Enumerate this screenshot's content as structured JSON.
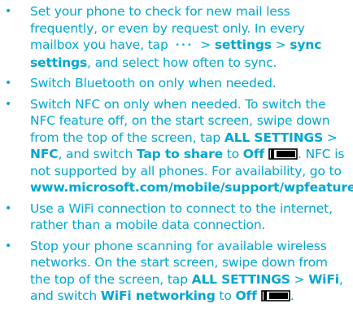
{
  "colors": {
    "text": "#00a7cf",
    "toggle_outline": "#000000"
  },
  "bullet_glyph": "•",
  "tips": [
    {
      "segments": [
        {
          "text": "Set your phone to check for new mail less frequently, or even by request only. In every mailbox you have, tap "
        },
        {
          "icon": "more-dots-icon",
          "glyph": "•••"
        },
        {
          "text": " > "
        },
        {
          "text": "settings",
          "bold": true
        },
        {
          "text": " > "
        },
        {
          "text": "sync settings",
          "bold": true
        },
        {
          "text": ", and select how often to sync."
        }
      ]
    },
    {
      "segments": [
        {
          "text": "Switch Bluetooth on only when needed."
        }
      ]
    },
    {
      "segments": [
        {
          "text": "Switch NFC on only when needed. To switch the NFC feature off, on the start screen, swipe down from the top of the screen, tap "
        },
        {
          "text": "ALL SETTINGS",
          "bold": true
        },
        {
          "text": " > "
        },
        {
          "text": "NFC",
          "bold": true
        },
        {
          "text": ", and switch "
        },
        {
          "text": "Tap to share",
          "bold": true
        },
        {
          "text": " to "
        },
        {
          "text": "Off",
          "bold": true
        },
        {
          "icon": "toggle-off-icon"
        },
        {
          "text": ". NFC is not supported by all phones. For availability, go to "
        },
        {
          "text": "www.microsoft.com/mobile/support/wpfeatures",
          "bold": true
        },
        {
          "text": "."
        }
      ]
    },
    {
      "segments": [
        {
          "text": "Use a WiFi connection to connect to the internet, rather than a mobile data connection."
        }
      ]
    },
    {
      "segments": [
        {
          "text": "Stop your phone scanning for available wireless networks. On the start screen, swipe down from the top of the screen, tap "
        },
        {
          "text": "ALL SETTINGS",
          "bold": true
        },
        {
          "text": " > "
        },
        {
          "text": "WiFi",
          "bold": true
        },
        {
          "text": ", and switch "
        },
        {
          "text": "WiFi networking",
          "bold": true
        },
        {
          "text": " to "
        },
        {
          "text": "Off",
          "bold": true
        },
        {
          "icon": "toggle-off-icon"
        },
        {
          "text": "."
        }
      ]
    }
  ]
}
